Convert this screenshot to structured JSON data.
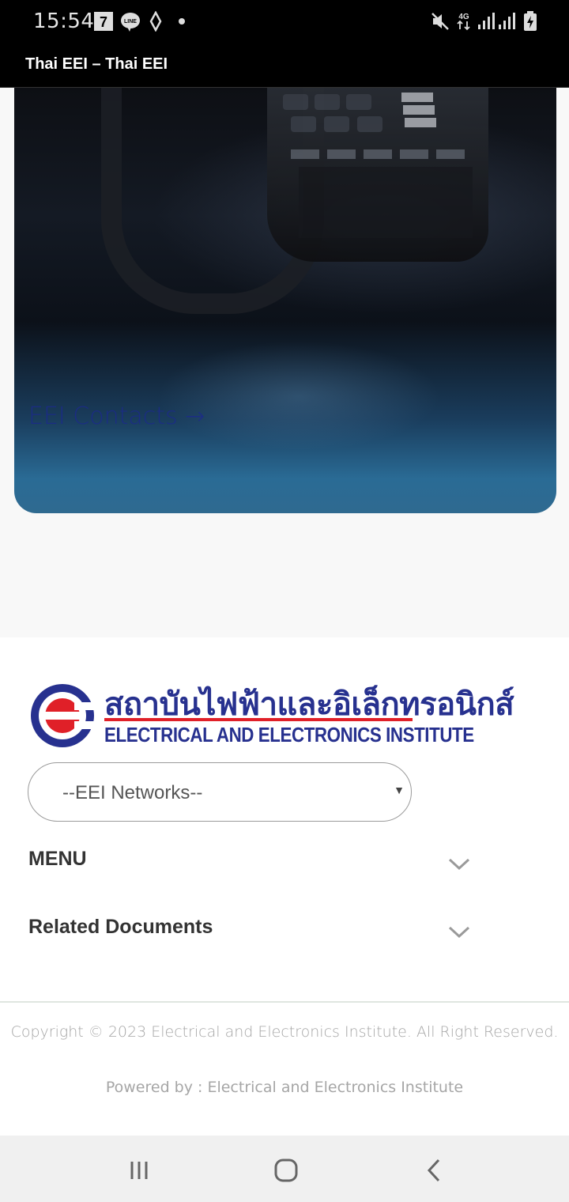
{
  "status_bar": {
    "time": "15:54",
    "icons": [
      "seven-eleven-icon",
      "line-icon",
      "signal-app-icon",
      "dot-icon",
      "mute-icon",
      "4g-icon",
      "signal-icon",
      "signal-icon",
      "battery-charging-icon"
    ],
    "network": "4G"
  },
  "title_bar": {
    "title": "Thai EEI – Thai EEI"
  },
  "hero": {
    "link_label": "EEI Contacts →"
  },
  "footer": {
    "logo": {
      "thai_text": "สถาบันไฟฟ้าและอิเล็กทรอนิกส์",
      "english_text": "ELECTRICAL AND ELECTRONICS INSTITUTE"
    },
    "networks_select": {
      "selected": "--EEI Networks--"
    },
    "accordions": [
      {
        "label": "MENU"
      },
      {
        "label": "Related Documents"
      }
    ],
    "copyright": "Copyright © 2023 Electrical and Electronics Institute. All Right Reserved.",
    "powered_by": "Powered by : Electrical and Electronics Institute"
  },
  "colors": {
    "brand_blue": "#27318f",
    "brand_red": "#e02028",
    "link_blue": "#1c2a8c"
  },
  "nav_bar": {
    "buttons": [
      "recent-apps-icon",
      "home-icon",
      "back-icon"
    ]
  }
}
